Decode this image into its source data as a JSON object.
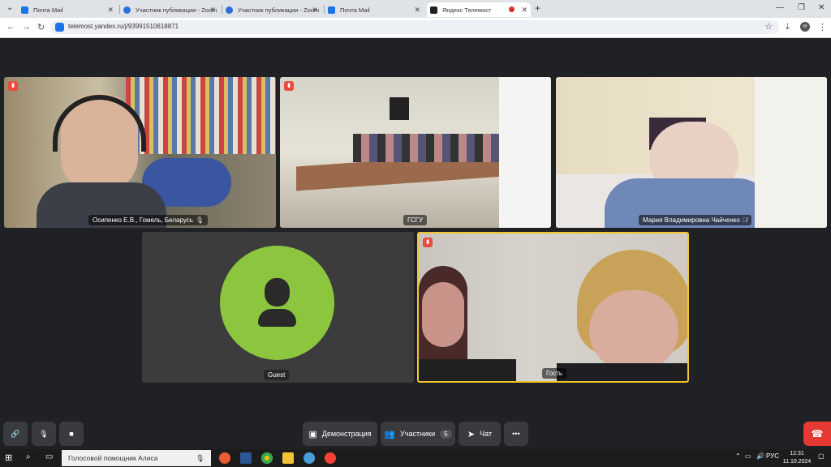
{
  "browser": {
    "tabs": [
      {
        "title": "Почта Mail"
      },
      {
        "title": "Участник публикации - Zoom"
      },
      {
        "title": "Участник публикации - Zoom"
      },
      {
        "title": "Почта Mail"
      },
      {
        "title": "Яндекс Телемост"
      }
    ],
    "url": "telemost.yandex.ru/j/93991510618871",
    "profile_initial": "m"
  },
  "participants": [
    {
      "name": "Осипенко Е.В., Гомель, Беларусь"
    },
    {
      "name": "ГСГУ"
    },
    {
      "name": "Мария Владимировна Чайченко"
    },
    {
      "name": "Guest"
    },
    {
      "name": "Гость"
    }
  ],
  "toolbar": {
    "demo_label": "Демонстрация",
    "participants_label": "Участники",
    "participants_count": "5",
    "chat_label": "Чат",
    "more_label": "•••"
  },
  "colors": {
    "accent_green": "#8cc63f",
    "active_speaker": "#f3c431",
    "hangup": "#e53935"
  },
  "taskbar": {
    "search_text": "Голосовой помощник Алиса",
    "language": "РУС",
    "time": "12:31",
    "date": "11.10.2024"
  }
}
